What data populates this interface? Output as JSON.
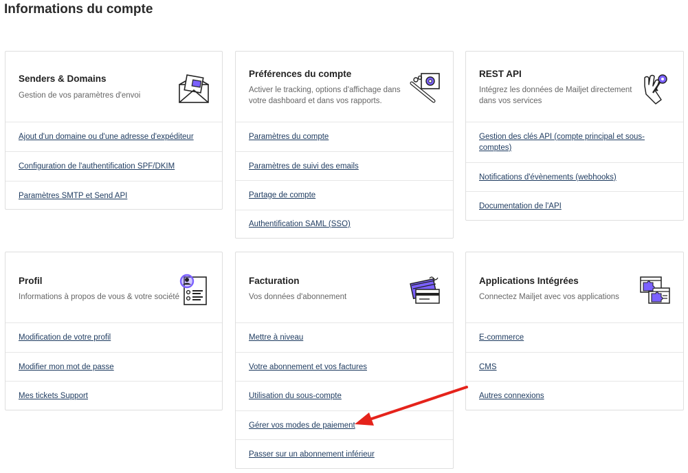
{
  "page_title": "Informations du compte",
  "cards": {
    "senders": {
      "title": "Senders & Domains",
      "desc": "Gestion de vos paramètres d'envoi",
      "icon": "envelope-document-icon",
      "links": [
        "Ajout d'un domaine ou d'une adresse d'expéditeur",
        "Configuration de l'authentification SPF/DKIM",
        "Paramètres SMTP et Send API"
      ]
    },
    "preferences": {
      "title": "Préférences du compte",
      "desc": "Activer le tracking, options d'affichage dans votre dashboard et dans vos rapports.",
      "icon": "wrench-gear-icon",
      "links": [
        "Paramètres du compte",
        "Paramètres de suivi des emails",
        "Partage de compte",
        "Authentification SAML (SSO)"
      ]
    },
    "rest_api": {
      "title": "REST API",
      "desc": "Intégrez les données de Mailjet directement dans vos services",
      "icon": "keys-hand-icon",
      "links": [
        "Gestion des clés API (compte principal et sous-comptes)",
        "Notifications d'évènements (webhooks)",
        "Documentation de l'API"
      ]
    },
    "profil": {
      "title": "Profil",
      "desc": "Informations à propos de vous & votre société",
      "icon": "profile-search-icon",
      "links": [
        "Modification de votre profil",
        "Modifier mon mot de passe",
        "Mes tickets Support"
      ]
    },
    "facturation": {
      "title": "Facturation",
      "desc": "Vos données d'abonnement",
      "icon": "credit-card-icon",
      "links": [
        "Mettre à niveau",
        "Votre abonnement et vos factures",
        "Utilisation du sous-compte",
        "Gérer vos modes de paiement",
        "Passer sur un abonnement inférieur"
      ]
    },
    "applications": {
      "title": "Applications Intégrées",
      "desc": "Connectez Mailjet avec vos applications",
      "icon": "puzzle-windows-icon",
      "links": [
        "E-commerce",
        "CMS",
        "Autres connexions"
      ]
    }
  },
  "colors": {
    "link": "#1d3a5f",
    "accent": "#7b61ff",
    "annotation_arrow": "#e5231b"
  }
}
